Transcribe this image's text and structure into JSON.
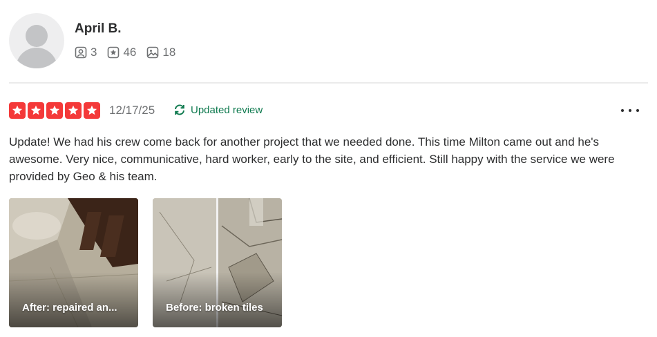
{
  "user": {
    "name": "April B.",
    "stats": {
      "friends": "3",
      "reviews": "46",
      "photos": "18"
    }
  },
  "review": {
    "rating": 5,
    "date": "12/17/25",
    "updated_label": "Updated review",
    "text": "Update! We had his crew come back for another project that we needed done. This time Milton came out and he's awesome. Very nice, communicative, hard worker, early to the site, and efficient. Still happy with the service we were provided by Geo & his team.",
    "photos": [
      {
        "caption": "After: repaired an..."
      },
      {
        "caption": "Before: broken tiles"
      }
    ]
  },
  "colors": {
    "star_red": "#f43939",
    "updated_green": "#0f7a4f",
    "muted_text": "#6e7072"
  }
}
